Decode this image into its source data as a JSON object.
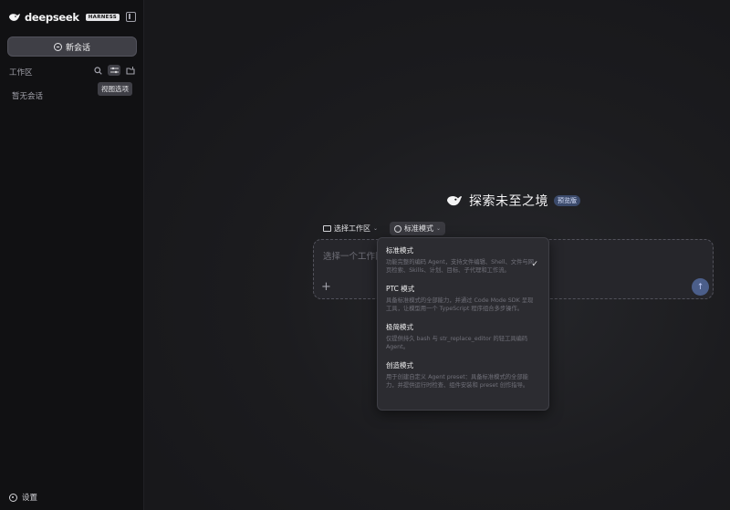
{
  "sidebar": {
    "brand": "deepseek",
    "badge": "HARNESS",
    "new_chat": "新会话",
    "workspace_label": "工作区",
    "tooltip": "视图选项",
    "empty_state": "暂无会话",
    "settings": "设置"
  },
  "main": {
    "title": "探索未至之境",
    "preview_badge": "预览版",
    "workspace_selector": "选择工作区",
    "mode_selector": "标准模式",
    "input_placeholder": "选择一个工作区",
    "modes": [
      {
        "title": "标准模式",
        "desc": "功能完整的编码 Agent，支持文件编辑、Shell、文件与网页检索、Skills、计划、目标、子代理和工作流。",
        "selected": true
      },
      {
        "title": "PTC 模式",
        "desc": "具备标准模式的全部能力，并通过 Code Mode SDK 呈现工具，让模型用一个 TypeScript 程序组合多步操作。",
        "selected": false
      },
      {
        "title": "极简模式",
        "desc": "仅提供持久 bash 与 str_replace_editor 的轻工具编码 Agent。",
        "selected": false
      },
      {
        "title": "创造模式",
        "desc": "用于创建自定义 Agent preset：具备标准模式的全部能力，并提供运行时检查、组件安装和 preset 创作指导。",
        "selected": false
      }
    ]
  },
  "icons": {
    "logo": "whale-icon",
    "sidebar_toggle": "sidebar-toggle-icon",
    "search": "search-icon",
    "view_options": "view-options-icon",
    "new_folder": "new-folder-icon",
    "gear": "gear-icon",
    "send": "arrow-up-icon"
  },
  "colors": {
    "background": "#18181b",
    "sidebar": "#111113",
    "accent": "#4b5e8a"
  }
}
